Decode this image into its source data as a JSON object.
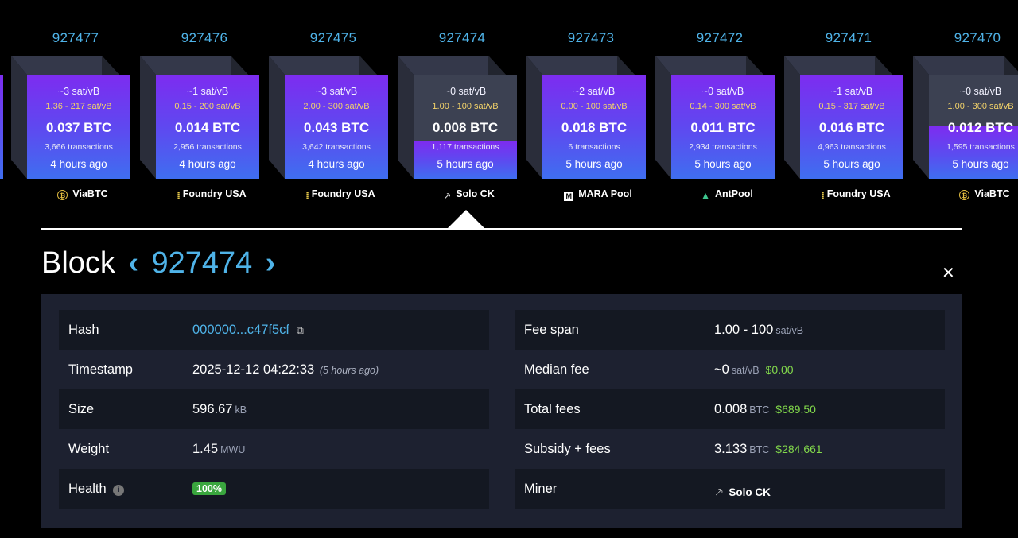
{
  "blocks": [
    {
      "height": "927477",
      "feerate": "~3 sat/vB",
      "range": "1.36 - 217 sat/vB",
      "btc": "0.037 BTC",
      "txs": "3,666 transactions",
      "ago": "4 hours ago",
      "pool": "ViaBTC",
      "pool_icon": "viabtc-icon",
      "fill": 1.0
    },
    {
      "height": "927476",
      "feerate": "~1 sat/vB",
      "range": "0.15 - 200 sat/vB",
      "btc": "0.014 BTC",
      "txs": "2,956 transactions",
      "ago": "4 hours ago",
      "pool": "Foundry USA",
      "pool_icon": "foundry-usa-icon",
      "fill": 1.0
    },
    {
      "height": "927475",
      "feerate": "~3 sat/vB",
      "range": "2.00 - 300 sat/vB",
      "btc": "0.043 BTC",
      "txs": "3,642 transactions",
      "ago": "4 hours ago",
      "pool": "Foundry USA",
      "pool_icon": "foundry-usa-icon",
      "fill": 1.0
    },
    {
      "height": "927474",
      "feerate": "~0 sat/vB",
      "range": "1.00 - 100 sat/vB",
      "btc": "0.008 BTC",
      "txs": "1,117 transactions",
      "ago": "5 hours ago",
      "pool": "Solo CK",
      "pool_icon": "pickaxe-icon",
      "fill": 0.36
    },
    {
      "height": "927473",
      "feerate": "~2 sat/vB",
      "range": "0.00 - 100 sat/vB",
      "btc": "0.018 BTC",
      "txs": "6 transactions",
      "ago": "5 hours ago",
      "pool": "MARA Pool",
      "pool_icon": "mara-icon",
      "fill": 1.0
    },
    {
      "height": "927472",
      "feerate": "~0 sat/vB",
      "range": "0.14 - 300 sat/vB",
      "btc": "0.011 BTC",
      "txs": "2,934 transactions",
      "ago": "5 hours ago",
      "pool": "AntPool",
      "pool_icon": "antpool-icon",
      "fill": 1.0
    },
    {
      "height": "927471",
      "feerate": "~1 sat/vB",
      "range": "0.15 - 317 sat/vB",
      "btc": "0.016 BTC",
      "txs": "4,963 transactions",
      "ago": "5 hours ago",
      "pool": "Foundry USA",
      "pool_icon": "foundry-usa-icon",
      "fill": 1.0
    },
    {
      "height": "927470",
      "feerate": "~0 sat/vB",
      "range": "1.00 - 300 sat/vB",
      "btc": "0.012 BTC",
      "txs": "1,595 transactions",
      "ago": "5 hours ago",
      "pool": "ViaBTC",
      "pool_icon": "viabtc-icon",
      "fill": 0.5
    }
  ],
  "heading": {
    "title": "Block",
    "prev": "‹",
    "number": "927474",
    "next": "›",
    "close": "✕"
  },
  "details": {
    "hash_label": "Hash",
    "hash_value": "000000...c47f5cf",
    "copy_icon": "⧉",
    "timestamp_label": "Timestamp",
    "timestamp_value": "2025-12-12 04:22:33",
    "timestamp_ago": "(5 hours ago)",
    "size_label": "Size",
    "size_value": "596.67",
    "size_unit": "kB",
    "weight_label": "Weight",
    "weight_value": "1.45",
    "weight_unit": "MWU",
    "health_label": "Health",
    "health_value": "100%",
    "feespan_label": "Fee span",
    "feespan_value": "1.00 - 100",
    "feespan_unit": "sat/vB",
    "median_label": "Median fee",
    "median_value": "~0",
    "median_unit": "sat/vB",
    "median_usd": "$0.00",
    "total_label": "Total fees",
    "total_value": "0.008",
    "total_unit": "BTC",
    "total_usd": "$689.50",
    "subsidy_label": "Subsidy + fees",
    "subsidy_value": "3.133",
    "subsidy_unit": "BTC",
    "subsidy_usd": "$284,661",
    "miner_label": "Miner",
    "miner_value": "Solo CK"
  },
  "colors": {
    "accent": "#4fb3e8",
    "usd": "#82d94b",
    "panel": "#1d2130",
    "range": "#f3d36a"
  }
}
